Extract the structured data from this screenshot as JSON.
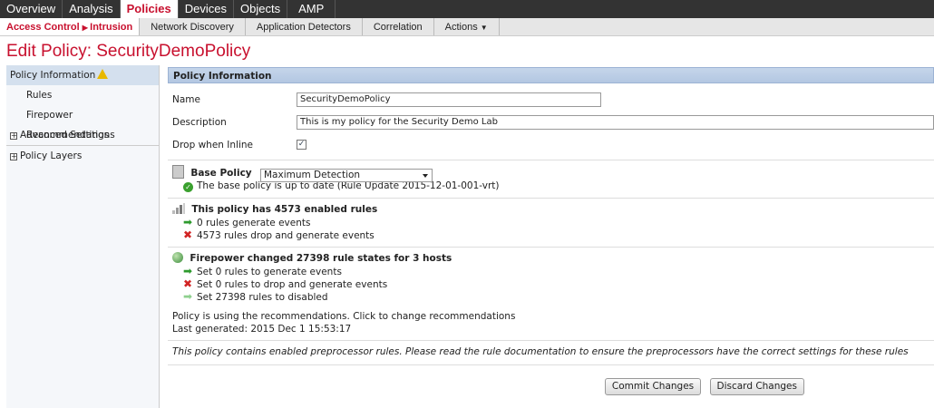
{
  "top_nav": {
    "items": [
      "Overview",
      "Analysis",
      "Policies",
      "Devices",
      "Objects",
      "AMP"
    ],
    "active": "Policies"
  },
  "sub_nav": {
    "access_control": "Access Control",
    "intrusion": "Intrusion",
    "items": [
      "Network Discovery",
      "Application Detectors",
      "Correlation",
      "Actions"
    ]
  },
  "page_title": "Edit Policy: SecurityDemoPolicy",
  "sidebar": {
    "items": [
      "Policy Information",
      "Rules",
      "Firepower Recommendations",
      "Advanced Settings",
      "Policy Layers"
    ]
  },
  "panel": {
    "header": "Policy Information",
    "name_label": "Name",
    "name_value": "SecurityDemoPolicy",
    "description_label": "Description",
    "description_value": "This is my policy for the Security Demo Lab",
    "drop_label": "Drop when Inline",
    "drop_checked": "✓"
  },
  "base_policy": {
    "label": "Base Policy",
    "selected": "Maximum Detection",
    "status": "The base policy is up to date (Rule Update 2015-12-01-001-vrt)"
  },
  "rules": {
    "title": "This policy has 4573 enabled rules",
    "generate": "0 rules generate events",
    "drop": "4573 rules drop and generate events"
  },
  "firepower": {
    "title": "Firepower changed 27398 rule states for 3 hosts",
    "generate": "Set 0 rules to generate events",
    "drop": "Set 0 rules to drop and generate events",
    "disabled": "Set 27398 rules to disabled",
    "recommendation": "Policy is using the recommendations. Click to change recommendations",
    "last_generated": "Last generated: 2015 Dec 1 15:53:17"
  },
  "note": "This policy contains enabled preprocessor rules. Please read the rule documentation to ensure the preprocessors have the correct settings for these rules",
  "buttons": {
    "commit": "Commit Changes",
    "discard": "Discard Changes"
  },
  "icons": {
    "warning": "warning-icon",
    "ok": "check-circle-icon",
    "arrow": "green-arrow-icon",
    "x": "red-x-icon"
  },
  "colors": {
    "brand": "#c8102e",
    "nav_bg": "#333333",
    "panel_header": "#c5d5ea"
  }
}
